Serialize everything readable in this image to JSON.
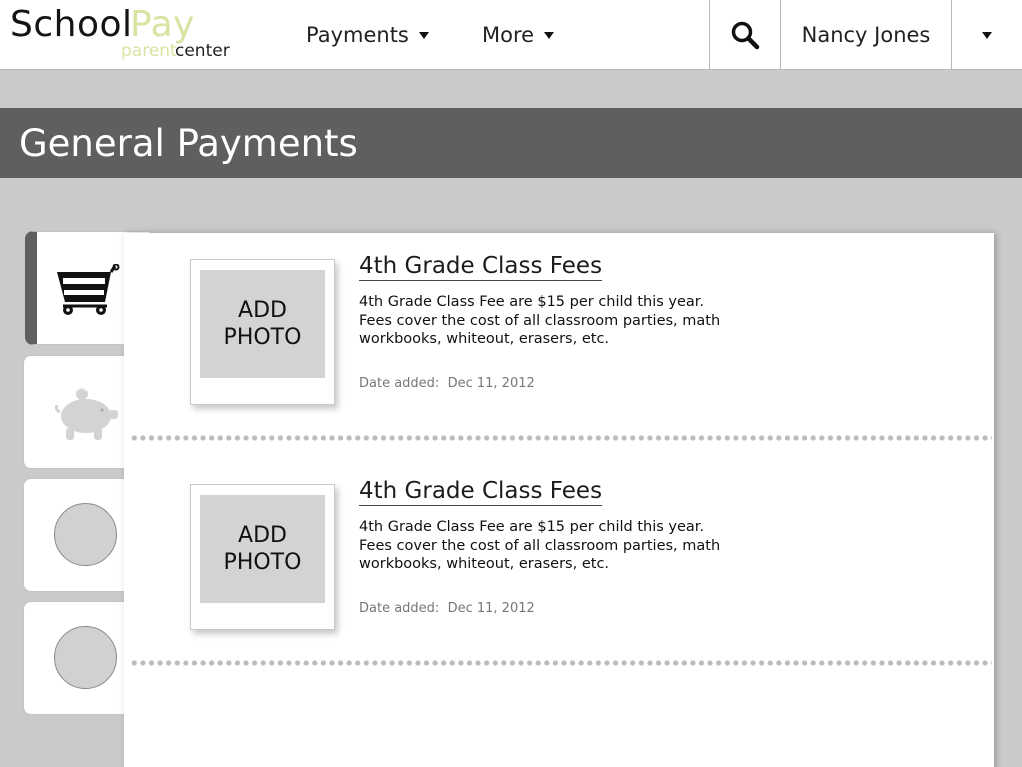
{
  "header": {
    "logo": {
      "school": "School",
      "pay": "Pay",
      "parent": "parent",
      "center": "center"
    },
    "nav": [
      {
        "label": "Payments"
      },
      {
        "label": "More"
      }
    ],
    "user_name": "Nancy Jones",
    "icons": {
      "search": "search-icon",
      "user_menu": "caret-down-icon"
    }
  },
  "page": {
    "title": "General Payments"
  },
  "side_tabs": [
    {
      "icon": "shopping-cart-icon",
      "active": true
    },
    {
      "icon": "piggy-bank-icon",
      "active": false
    },
    {
      "icon": "circle-icon",
      "active": false
    },
    {
      "icon": "circle-icon",
      "active": false
    }
  ],
  "items": [
    {
      "photo_label": "ADD\nPHOTO",
      "title": "4th Grade Class Fees",
      "description": "4th Grade Class Fee are $15 per child this year.\nFees cover the cost of all classroom parties, math\n workbooks, whiteout, erasers, etc.",
      "date_label": "Date added:",
      "date_value": "Dec 11, 2012"
    },
    {
      "photo_label": "ADD\nPHOTO",
      "title": "4th Grade Class Fees",
      "description": "4th Grade Class Fee are $15 per child this year.\nFees cover the cost of all classroom parties, math\n workbooks, whiteout, erasers, etc.",
      "date_label": "Date added:",
      "date_value": "Dec 11, 2012"
    }
  ],
  "colors": {
    "background": "#cacaca",
    "title_band": "#5f5f5f",
    "logo_accent": "#d8e4a2",
    "photo_placeholder": "#d3d3d3"
  }
}
